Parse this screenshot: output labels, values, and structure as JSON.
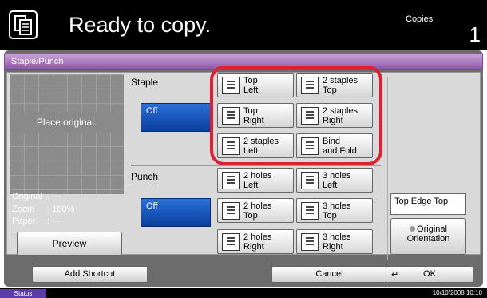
{
  "header": {
    "title": "Ready to copy.",
    "copies_label": "Copies",
    "copies_count": "1"
  },
  "screen": {
    "tab_title": "Staple/Punch"
  },
  "preview": {
    "place_original": "Place original.",
    "info": [
      {
        "key": "Original",
        "value": ": ---"
      },
      {
        "key": "Zoom",
        "value": ": 100%"
      },
      {
        "key": "Paper",
        "value": ": ---"
      }
    ],
    "preview_button": "Preview"
  },
  "staple": {
    "label": "Staple",
    "off_label": "Off",
    "options": [
      {
        "line1": "Top",
        "line2": "Left"
      },
      {
        "line1": "2 staples",
        "line2": "Top"
      },
      {
        "line1": "Top",
        "line2": "Right"
      },
      {
        "line1": "2 staples",
        "line2": "Right"
      },
      {
        "line1": "2 staples",
        "line2": "Left"
      },
      {
        "line1": "Bind",
        "line2": "and Fold"
      }
    ]
  },
  "punch": {
    "label": "Punch",
    "off_label": "Off",
    "options": [
      {
        "line1": "2 holes",
        "line2": "Left"
      },
      {
        "line1": "3 holes",
        "line2": "Left"
      },
      {
        "line1": "2 holes",
        "line2": "Top"
      },
      {
        "line1": "3 holes",
        "line2": "Top"
      },
      {
        "line1": "2 holes",
        "line2": "Right"
      },
      {
        "line1": "3 holes",
        "line2": "Right"
      }
    ]
  },
  "orientation": {
    "value": "Top Edge Top",
    "button_line1": "Original",
    "button_line2": "Orientation"
  },
  "footer": {
    "add_shortcut": "Add Shortcut",
    "cancel": "Cancel",
    "ok": "OK"
  },
  "status": {
    "label": "Status",
    "datetime": "10/10/2008   10:10"
  },
  "colors": {
    "selected_blue": "#0b3f9e",
    "highlight_red": "#e02030",
    "tab_purple": "#8e5aa8"
  }
}
